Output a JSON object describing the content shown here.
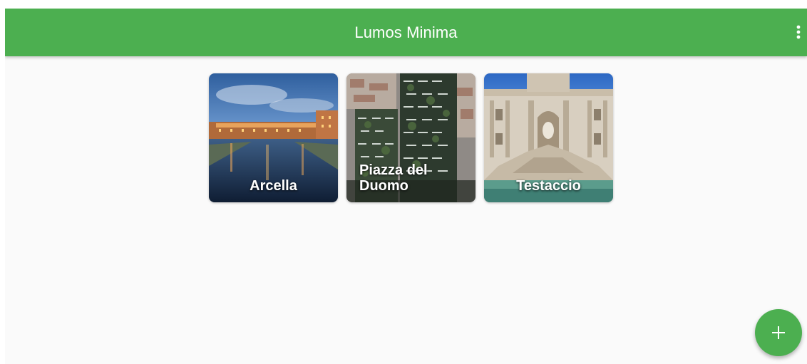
{
  "app": {
    "title": "Lumos Minima",
    "accent_color": "#4caf50",
    "menu_icon": "more-vert-icon"
  },
  "tiles": [
    {
      "label": "Arcella"
    },
    {
      "label": "Piazza del Duomo"
    },
    {
      "label": "Testaccio"
    }
  ],
  "fab": {
    "icon": "plus-icon",
    "glyph": "+"
  }
}
